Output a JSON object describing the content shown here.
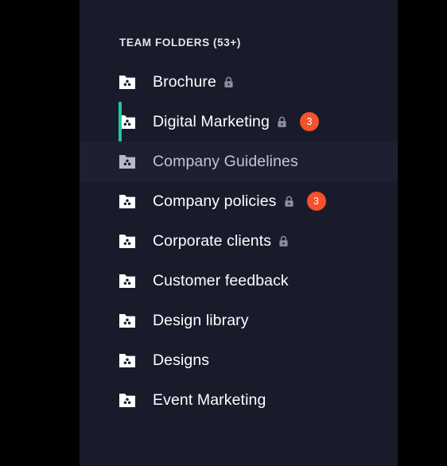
{
  "sidebar": {
    "section_title": "TEAM FOLDERS (53+)",
    "colors": {
      "background": "#191B2B",
      "page_background": "#000000",
      "active_accent": "#23C69B",
      "badge": "#F4512C",
      "hover_background": "#1E2032",
      "text": "#FFFFFF",
      "text_dim": "#C3C6D2",
      "icon_dim": "#B6B9C6",
      "lock_icon": "#8B8F9E"
    },
    "items": [
      {
        "label": "Brochure",
        "locked": true,
        "badge": null,
        "active": false,
        "hovered": false,
        "icon": "folder-icon",
        "lock_icon": "lock-icon"
      },
      {
        "label": "Digital Marketing",
        "locked": true,
        "badge": "3",
        "active": true,
        "hovered": false,
        "icon": "folder-icon",
        "lock_icon": "lock-icon"
      },
      {
        "label": "Company Guidelines",
        "locked": false,
        "badge": null,
        "active": false,
        "hovered": true,
        "icon": "folder-icon",
        "lock_icon": null
      },
      {
        "label": "Company policies",
        "locked": true,
        "badge": "3",
        "active": false,
        "hovered": false,
        "icon": "folder-icon",
        "lock_icon": "lock-icon"
      },
      {
        "label": "Corporate clients",
        "locked": true,
        "badge": null,
        "active": false,
        "hovered": false,
        "icon": "folder-icon",
        "lock_icon": "lock-icon"
      },
      {
        "label": "Customer feedback",
        "locked": false,
        "badge": null,
        "active": false,
        "hovered": false,
        "icon": "folder-icon",
        "lock_icon": null
      },
      {
        "label": "Design library",
        "locked": false,
        "badge": null,
        "active": false,
        "hovered": false,
        "icon": "folder-icon",
        "lock_icon": null
      },
      {
        "label": "Designs",
        "locked": false,
        "badge": null,
        "active": false,
        "hovered": false,
        "icon": "folder-icon",
        "lock_icon": null
      },
      {
        "label": "Event Marketing",
        "locked": false,
        "badge": null,
        "active": false,
        "hovered": false,
        "icon": "folder-icon",
        "lock_icon": null
      }
    ]
  }
}
